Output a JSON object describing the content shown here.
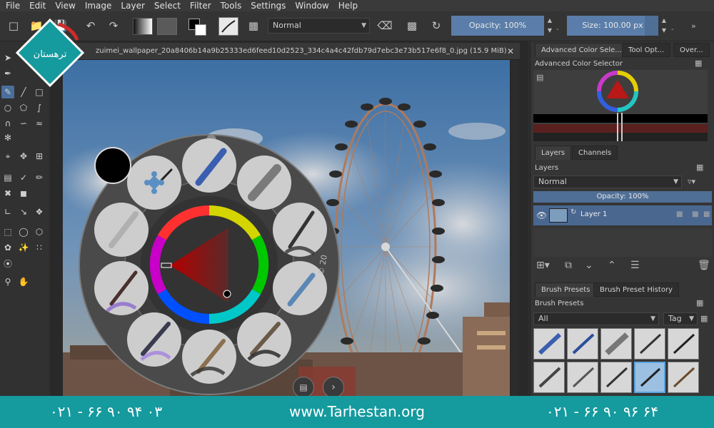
{
  "menu": [
    "File",
    "Edit",
    "View",
    "Image",
    "Layer",
    "Select",
    "Filter",
    "Tools",
    "Settings",
    "Window",
    "Help"
  ],
  "toolbar": {
    "blend_mode": "Normal",
    "opacity_label": "Opacity:  100%",
    "opacity_value": 1.0,
    "size_label": "Size:  100.00 px",
    "size_value_fraction": 0.85
  },
  "document": {
    "tab_title": "zuimei_wallpaper_20a8406b14a9b25333ed6feed10d2523_334c4a4c42fdb79d7ebc3e73b517e6f8_0.jpg (15.9 MiB)"
  },
  "dockers": {
    "top_tabs": [
      "Advanced Color Sele...",
      "Tool Opt...",
      "Over..."
    ],
    "color_selector_title": "Advanced Color Selector",
    "layer_tabs": [
      "Layers",
      "Channels"
    ],
    "layers_title": "Layers",
    "layer_blend": "Normal",
    "layer_opacity_label": "Opacity:  100%",
    "layer_name": "Layer 1",
    "brush_tabs": [
      "Brush Presets",
      "Brush Preset History"
    ],
    "brush_title": "Brush Presets",
    "brush_filter": "All",
    "brush_tag": "Tag"
  },
  "popup_palette": {
    "watermark": "© 20"
  },
  "logo": {
    "text": "ترهستان"
  },
  "footer": {
    "phone_left": "۰۲۱ - ۶۶ ۹۰ ۹۴ ۰۳",
    "site": "www.Tarhestan.org",
    "phone_right": "۰۲۱ - ۶۶ ۹۰ ۹۶ ۶۴"
  },
  "colors": {
    "footer_bg": "#159a9e",
    "accent": "#4f6f96",
    "logo_teal": "#159a9e"
  }
}
